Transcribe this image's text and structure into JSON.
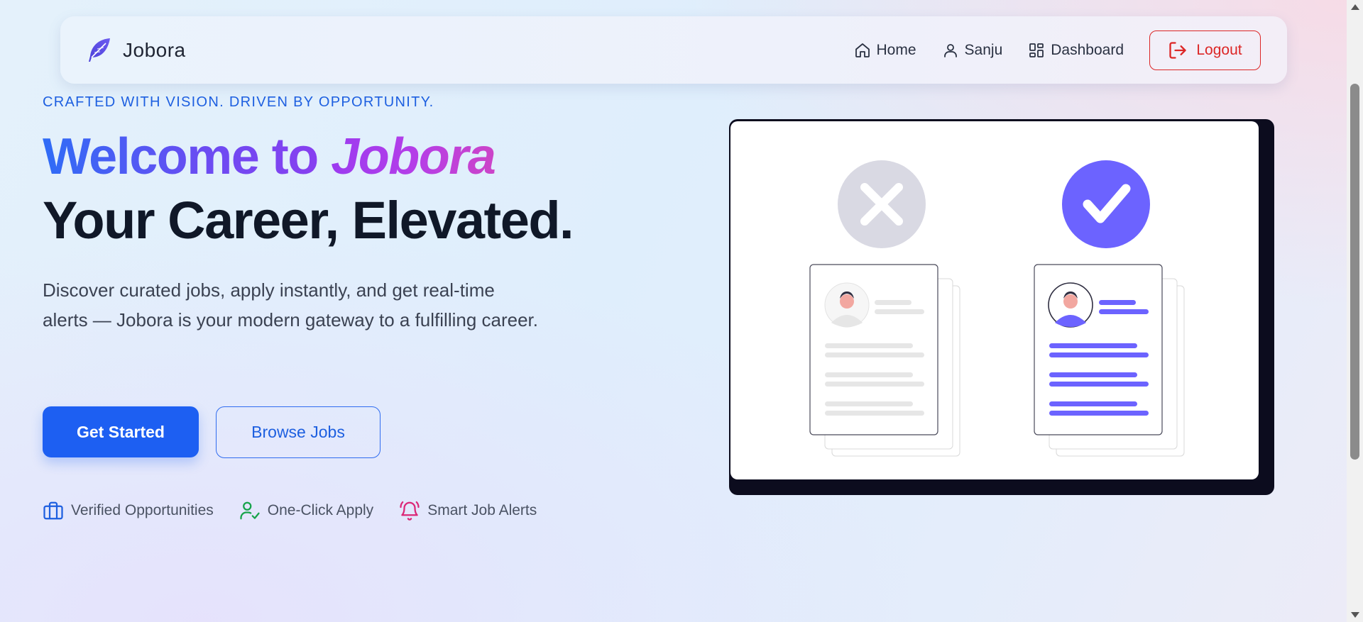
{
  "app": {
    "name": "Jobora"
  },
  "nav": {
    "home": "Home",
    "user": "Sanju",
    "dashboard": "Dashboard",
    "logout": "Logout"
  },
  "hero": {
    "tagline": "CRAFTED WITH VISION. DRIVEN BY OPPORTUNITY.",
    "headline_part1": "Welcome to ",
    "headline_part2": "Jobora",
    "headline_line2": "Your Career, Elevated.",
    "description": "Discover curated jobs, apply instantly, and get real-time alerts — Jobora is your modern gateway to a fulfilling career.",
    "primary_cta": "Get Started",
    "secondary_cta": "Browse Jobs"
  },
  "features": [
    {
      "label": "Verified Opportunities",
      "icon": "briefcase-icon",
      "color": "#1d5fe0"
    },
    {
      "label": "One-Click Apply",
      "icon": "user-check-icon",
      "color": "#16a34a"
    },
    {
      "label": "Smart Job Alerts",
      "icon": "bell-ring-icon",
      "color": "#db2777"
    }
  ],
  "colors": {
    "primary": "#1d5ff2",
    "danger": "#dc2626",
    "accent_purple": "#6c63ff",
    "text_dark": "#101828"
  }
}
